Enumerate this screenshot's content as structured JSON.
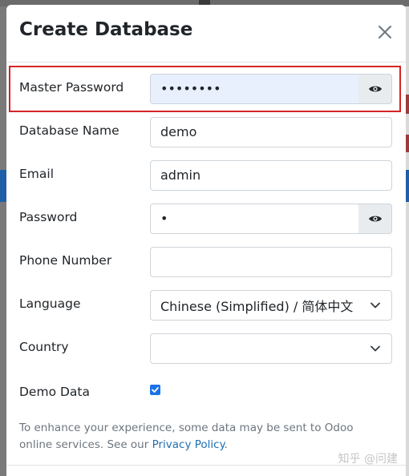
{
  "modal": {
    "title": "Create Database"
  },
  "fields": {
    "master_password": {
      "label": "Master Password",
      "value": "••••••••"
    },
    "database_name": {
      "label": "Database Name",
      "value": "demo"
    },
    "email": {
      "label": "Email",
      "value": "admin"
    },
    "password": {
      "label": "Password",
      "value": "•"
    },
    "phone": {
      "label": "Phone Number",
      "value": ""
    },
    "language": {
      "label": "Language",
      "value": "Chinese (Simplified) / 简体中文"
    },
    "country": {
      "label": "Country",
      "value": ""
    },
    "demo_data": {
      "label": "Demo Data",
      "checked": true
    }
  },
  "footnote": {
    "text": "To enhance your experience, some data may be sent to Odoo online services. See our ",
    "link": "Privacy Policy",
    "end": "."
  },
  "watermark": "知乎 @问建",
  "colors": {
    "accent": "#1a73e8",
    "highlight": "#d42525",
    "link": "#1f6fb2"
  },
  "icons": {
    "close": "close-icon",
    "eye": "eye-icon",
    "chevron": "chevron-down-icon",
    "check": "check-icon"
  }
}
